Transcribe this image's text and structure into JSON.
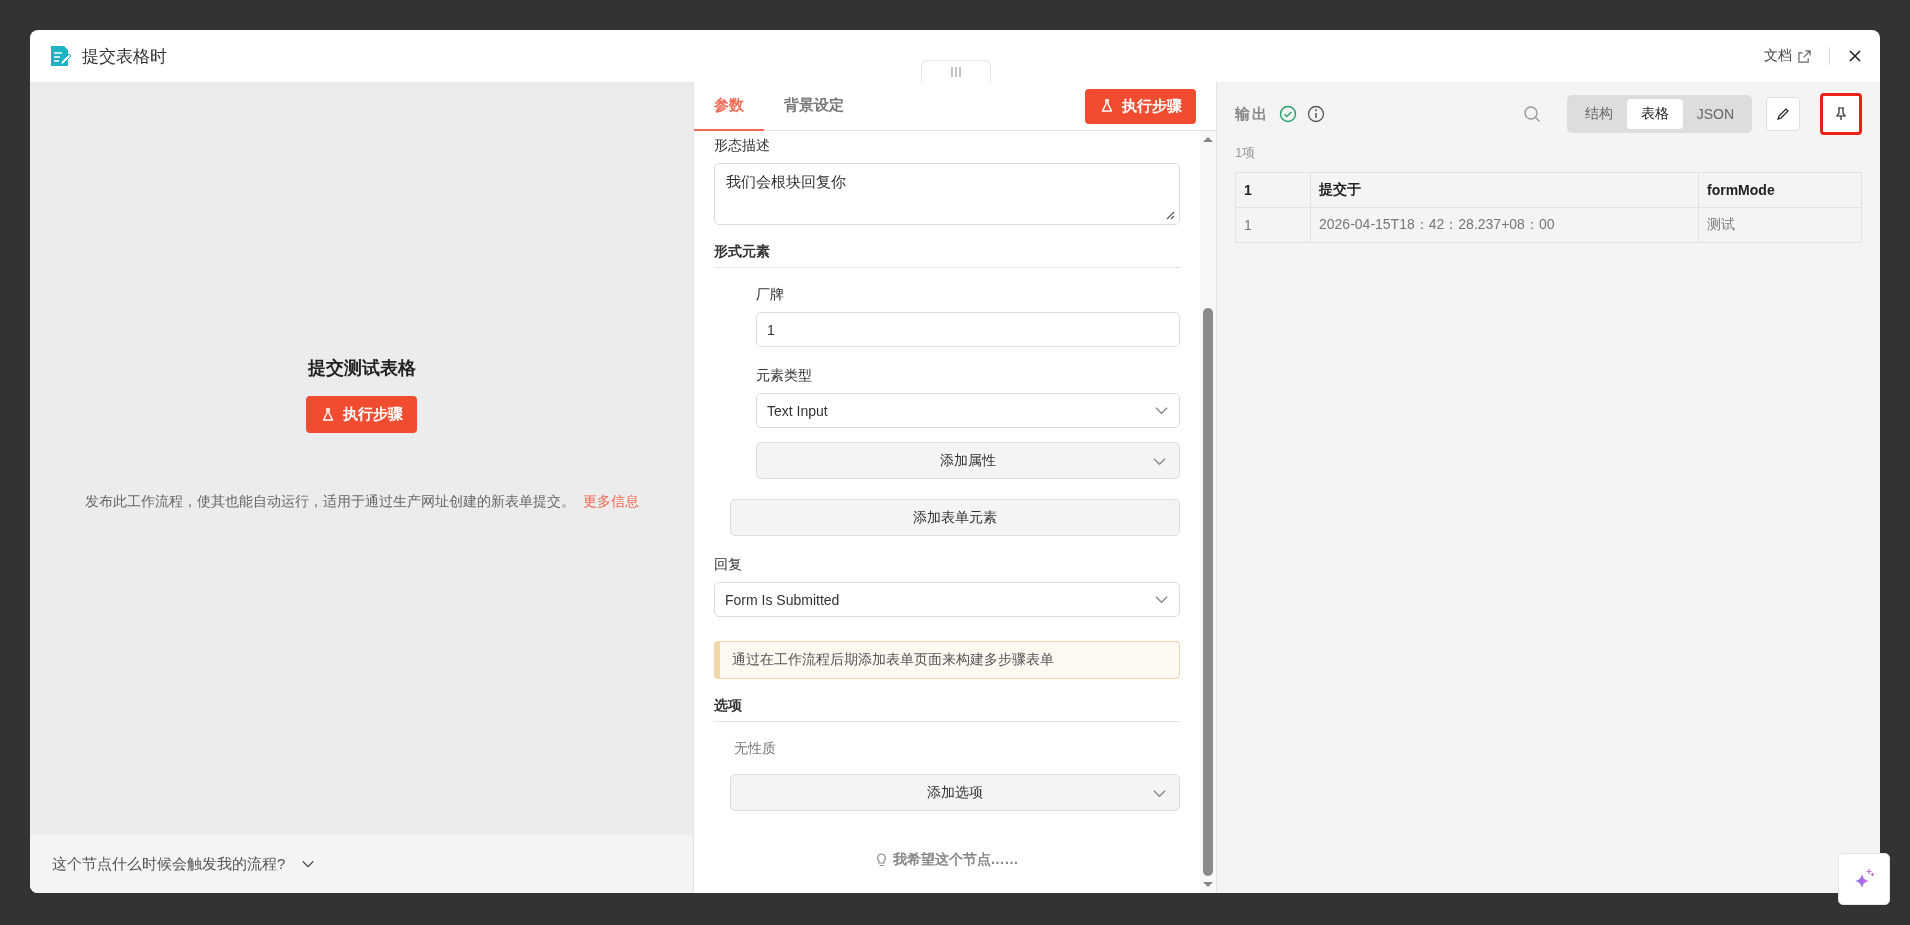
{
  "modal": {
    "title": "提交表格时",
    "docs_link": "文档"
  },
  "left_panel": {
    "heading": "提交测试表格",
    "run_button": "执行步骤",
    "description": "发布此工作流程，使其也能自动运行，适用于通过生产网址创建的新表单提交。",
    "more_link": "更多信息",
    "footer_question": "这个节点什么时候会触发我的流程?"
  },
  "params_panel": {
    "tabs": [
      {
        "label": "参数",
        "selected": true
      },
      {
        "label": "背景设定",
        "selected": false
      }
    ],
    "run_button": "执行步骤",
    "form_description": {
      "label": "形态描述",
      "value": "我们会根块回复你"
    },
    "form_elements": {
      "heading": "形式元素",
      "fields": [
        {
          "label": "厂牌",
          "kind": "text",
          "value": "1"
        },
        {
          "label": "元素类型",
          "kind": "select",
          "value": "Text Input"
        }
      ],
      "add_attribute": "添加属性",
      "add_element": "添加表单元素"
    },
    "respond": {
      "label": "回复",
      "value": "Form Is Submitted"
    },
    "notice": "通过在工作流程后期添加表单页面来构建多步骤表单",
    "options": {
      "heading": "选项",
      "empty_text": "无性质",
      "add_option": "添加选项"
    },
    "feedback": "我希望这个节点……"
  },
  "output_panel": {
    "title": "输出",
    "succeeded": true,
    "view_tabs": [
      {
        "label": "结构",
        "selected": false
      },
      {
        "label": "表格",
        "selected": true
      },
      {
        "label": "JSON",
        "selected": false
      }
    ],
    "pin_highlighted": true,
    "item_count": "1项",
    "table": {
      "columns": [
        "1",
        "提交于",
        "formMode"
      ],
      "rows": [
        [
          "1",
          "2026-04-15T18：42：28.237+08：00",
          "测试"
        ]
      ]
    }
  }
}
